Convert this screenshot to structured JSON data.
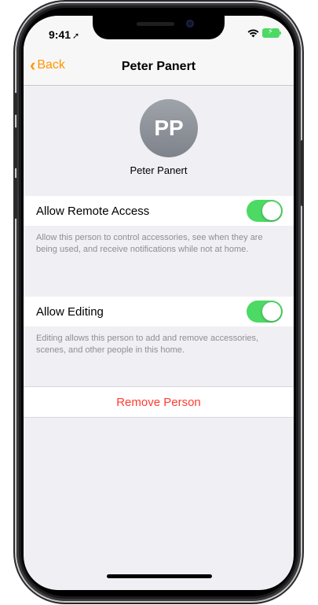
{
  "status_bar": {
    "time": "9:41",
    "location_glyph": "➚"
  },
  "navbar": {
    "back_label": "Back",
    "title": "Peter Panert"
  },
  "profile": {
    "initials": "PP",
    "name": "Peter Panert"
  },
  "settings": [
    {
      "label": "Allow Remote Access",
      "enabled": true,
      "footer": "Allow this person to control accessories, see when they are being used, and receive notifications while not at home."
    },
    {
      "label": "Allow Editing",
      "enabled": true,
      "footer": "Editing allows this person to add and remove accessories, scenes, and other people in this home."
    }
  ],
  "actions": {
    "remove_label": "Remove Person"
  },
  "colors": {
    "accent": "#ff9500",
    "toggle_on": "#4cd964",
    "destructive": "#ff3b30",
    "background": "#efeff4"
  }
}
